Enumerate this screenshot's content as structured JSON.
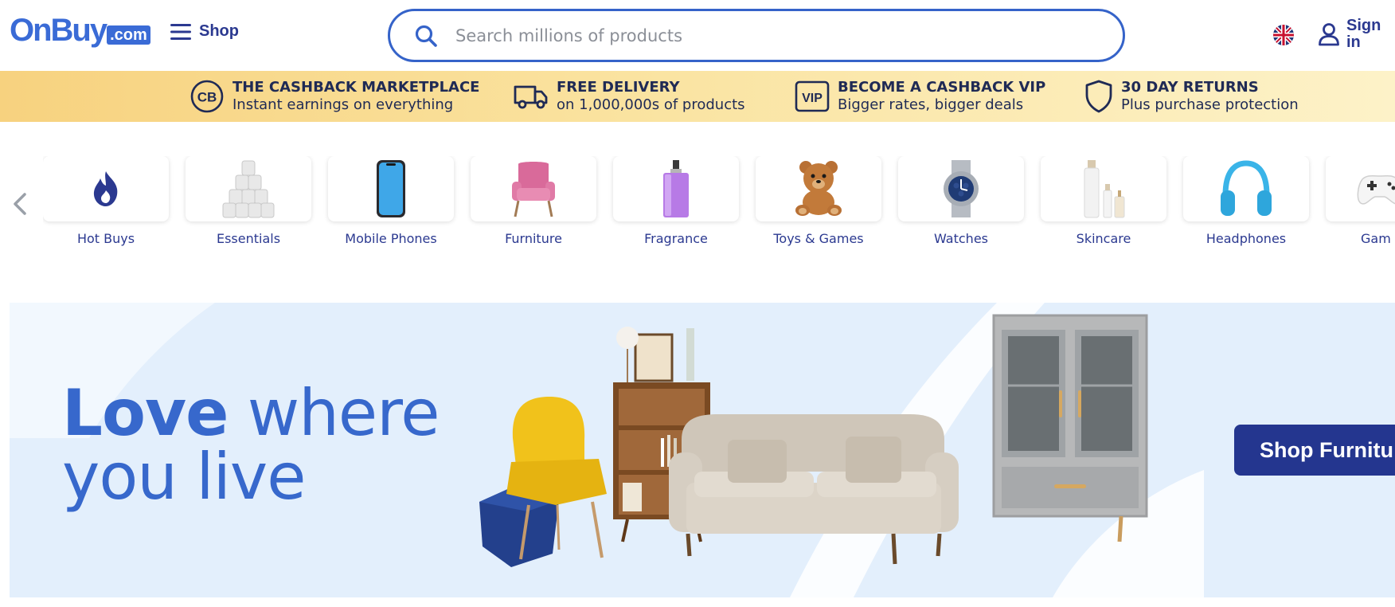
{
  "header": {
    "logo_main": "OnBuy",
    "logo_suffix": ".com",
    "shop_label": "Shop",
    "search_placeholder": "Search millions of products",
    "signin_label": "Sign in"
  },
  "promo": [
    {
      "title": "THE CASHBACK MARKETPLACE",
      "subtitle": "Instant earnings on everything",
      "icon": "cashback-icon"
    },
    {
      "title": "FREE DELIVERY",
      "subtitle": "on 1,000,000s of products",
      "icon": "truck-icon"
    },
    {
      "title": "BECOME A CASHBACK VIP",
      "subtitle": "Bigger rates, bigger deals",
      "icon": "vip-icon",
      "icon_text": "VIP"
    },
    {
      "title": "30 DAY RETURNS",
      "subtitle": "Plus purchase protection",
      "icon": "shield-icon"
    }
  ],
  "categories": [
    {
      "label": "Hot Buys",
      "icon": "flame-icon"
    },
    {
      "label": "Essentials",
      "icon": "toilet-roll-icon"
    },
    {
      "label": "Mobile Phones",
      "icon": "phone-icon"
    },
    {
      "label": "Furniture",
      "icon": "armchair-icon"
    },
    {
      "label": "Fragrance",
      "icon": "perfume-icon"
    },
    {
      "label": "Toys & Games",
      "icon": "teddy-bear-icon"
    },
    {
      "label": "Watches",
      "icon": "watch-icon"
    },
    {
      "label": "Skincare",
      "icon": "skincare-bottles-icon"
    },
    {
      "label": "Headphones",
      "icon": "headphones-icon"
    },
    {
      "label": "Gam",
      "icon": "gamepad-icon"
    }
  ],
  "hero": {
    "line1_bold": "Love",
    "line1_rest": " where",
    "line2": "you live",
    "cta_label": "Shop Furnitu"
  },
  "colors": {
    "brand_blue": "#3a6bd6",
    "navy": "#2b3990",
    "promo_yellow": "#f7d27f",
    "hero_bg": "#e3effc",
    "cta_bg": "#24368f"
  }
}
